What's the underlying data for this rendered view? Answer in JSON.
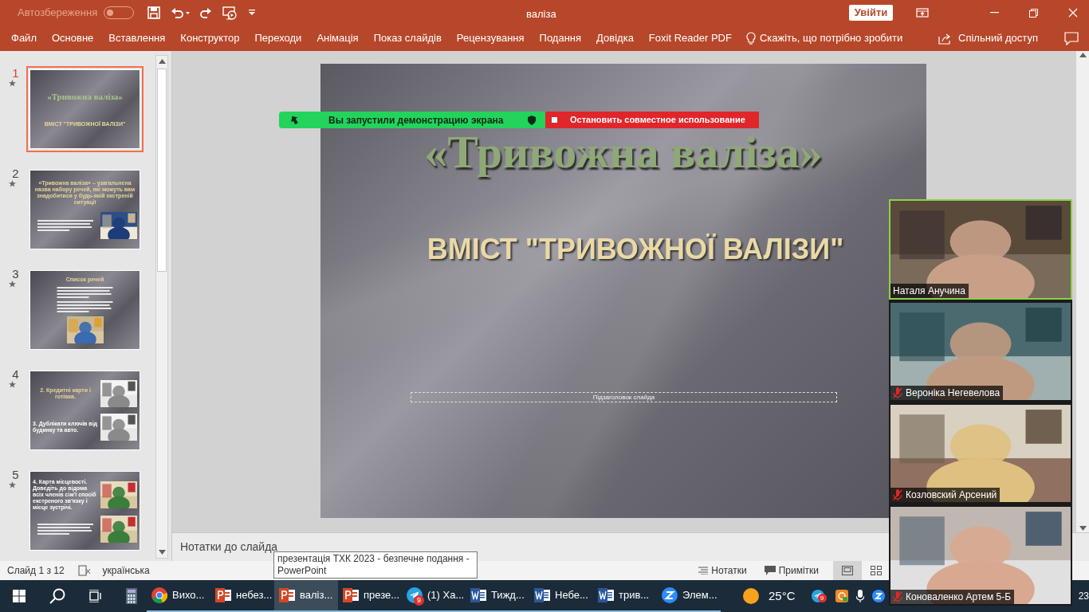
{
  "window": {
    "autosave_label": "Автозбереження",
    "autosave_on": false,
    "title": "валіза",
    "signin_button": "Увійти"
  },
  "ribbon_tabs": [
    {
      "label": "Файл"
    },
    {
      "label": "Основне"
    },
    {
      "label": "Вставлення"
    },
    {
      "label": "Конструктор"
    },
    {
      "label": "Переходи"
    },
    {
      "label": "Анімація"
    },
    {
      "label": "Показ слайдів"
    },
    {
      "label": "Рецензування"
    },
    {
      "label": "Подання"
    },
    {
      "label": "Довідка"
    },
    {
      "label": "Foxit Reader PDF"
    }
  ],
  "tell_me": "Скажіть, що потрібно зробити",
  "share": "Спільний доступ",
  "thumbnails": [
    {
      "number": "1",
      "selected": true,
      "rows": [
        [
          {
            "kind": "title",
            "text": "«Тривожна валіза»"
          }
        ],
        [
          {
            "kind": "subtitle",
            "text": "ВМІСТ \"ТРИВОЖНОЇ ВАЛІЗИ\""
          }
        ]
      ]
    },
    {
      "number": "2",
      "selected": false,
      "rows": [
        [
          {
            "kind": "heading",
            "text": "«Тривожна валіза» – узагальнена назва набору речей, які можуть вам знадобитися у будь-якій екстреній ситуації"
          }
        ],
        [
          {
            "kind": "text_lines"
          },
          {
            "kind": "picture"
          }
        ]
      ]
    },
    {
      "number": "3",
      "selected": false,
      "rows": [
        [
          {
            "kind": "heading",
            "text": "Список речей"
          }
        ],
        [
          {
            "kind": "text_lines"
          }
        ],
        [
          {
            "kind": "text_lines"
          }
        ],
        [
          {
            "kind": "picture"
          }
        ]
      ]
    },
    {
      "number": "4",
      "selected": false,
      "rows": [
        [
          {
            "kind": "heading",
            "text": "2. Кредитні карти і готівка."
          },
          {
            "kind": "picture"
          }
        ],
        [
          {
            "kind": "body",
            "text": "3. Дублікати ключів від будинку та авто."
          },
          {
            "kind": "picture"
          }
        ]
      ]
    },
    {
      "number": "5",
      "selected": false,
      "rows": [
        [
          {
            "kind": "body",
            "text": "4. Карта місцевості. Доведіть до відома всіх членів сім'ї спосіб екстреного зв'язку і місце зустрічі."
          },
          {
            "kind": "picture"
          }
        ],
        [
          {
            "kind": "text_lines"
          },
          {
            "kind": "picture"
          }
        ]
      ]
    }
  ],
  "slide": {
    "title": "«Тривожна валіза»",
    "subtitle": "ВМІСТ \"ТРИВОЖНОЇ ВАЛІЗИ\"",
    "placeholder": "Підзаголовок слайда"
  },
  "notes_placeholder": "Нотатки до слайда",
  "status_bar": {
    "slide_counter": "Слайд 1 з 12",
    "language": "українська",
    "notes": "Нотатки",
    "comments": "Примітки"
  },
  "tooltip": "презентація ТХК 2023  -  безпечне подання - PowerPoint",
  "share_bar": {
    "status": "Вы запустили демонстрацию экрана",
    "stop": "Остановить совместное использование"
  },
  "participants": [
    {
      "name": "Наталя Анучина",
      "muted": false,
      "speaking": true
    },
    {
      "name": "Вероніка Негевелова",
      "muted": true,
      "speaking": false
    },
    {
      "name": "Козловский Арсений",
      "muted": true,
      "speaking": false
    },
    {
      "name": "Коноваленко Артем 5-Б",
      "muted": true,
      "speaking": false
    }
  ],
  "taskbar": {
    "apps": [
      {
        "kind": "chrome",
        "label": "Вихо...",
        "active": false
      },
      {
        "kind": "powerpoint",
        "label": "небез...",
        "active": false
      },
      {
        "kind": "powerpoint",
        "label": "валіз...",
        "active": true
      },
      {
        "kind": "powerpoint",
        "label": "презе...",
        "active": false
      },
      {
        "kind": "telegram",
        "label": "(1) Ха...",
        "active": false,
        "badge": "9"
      },
      {
        "kind": "word",
        "label": "Тижд...",
        "active": false
      },
      {
        "kind": "word",
        "label": "Небе...",
        "active": false
      },
      {
        "kind": "word",
        "label": "трив...",
        "active": false
      },
      {
        "kind": "zoom",
        "label": "Элем...",
        "active": false
      }
    ],
    "weather": "25°C",
    "tray_badge": "9",
    "clock": "23"
  }
}
